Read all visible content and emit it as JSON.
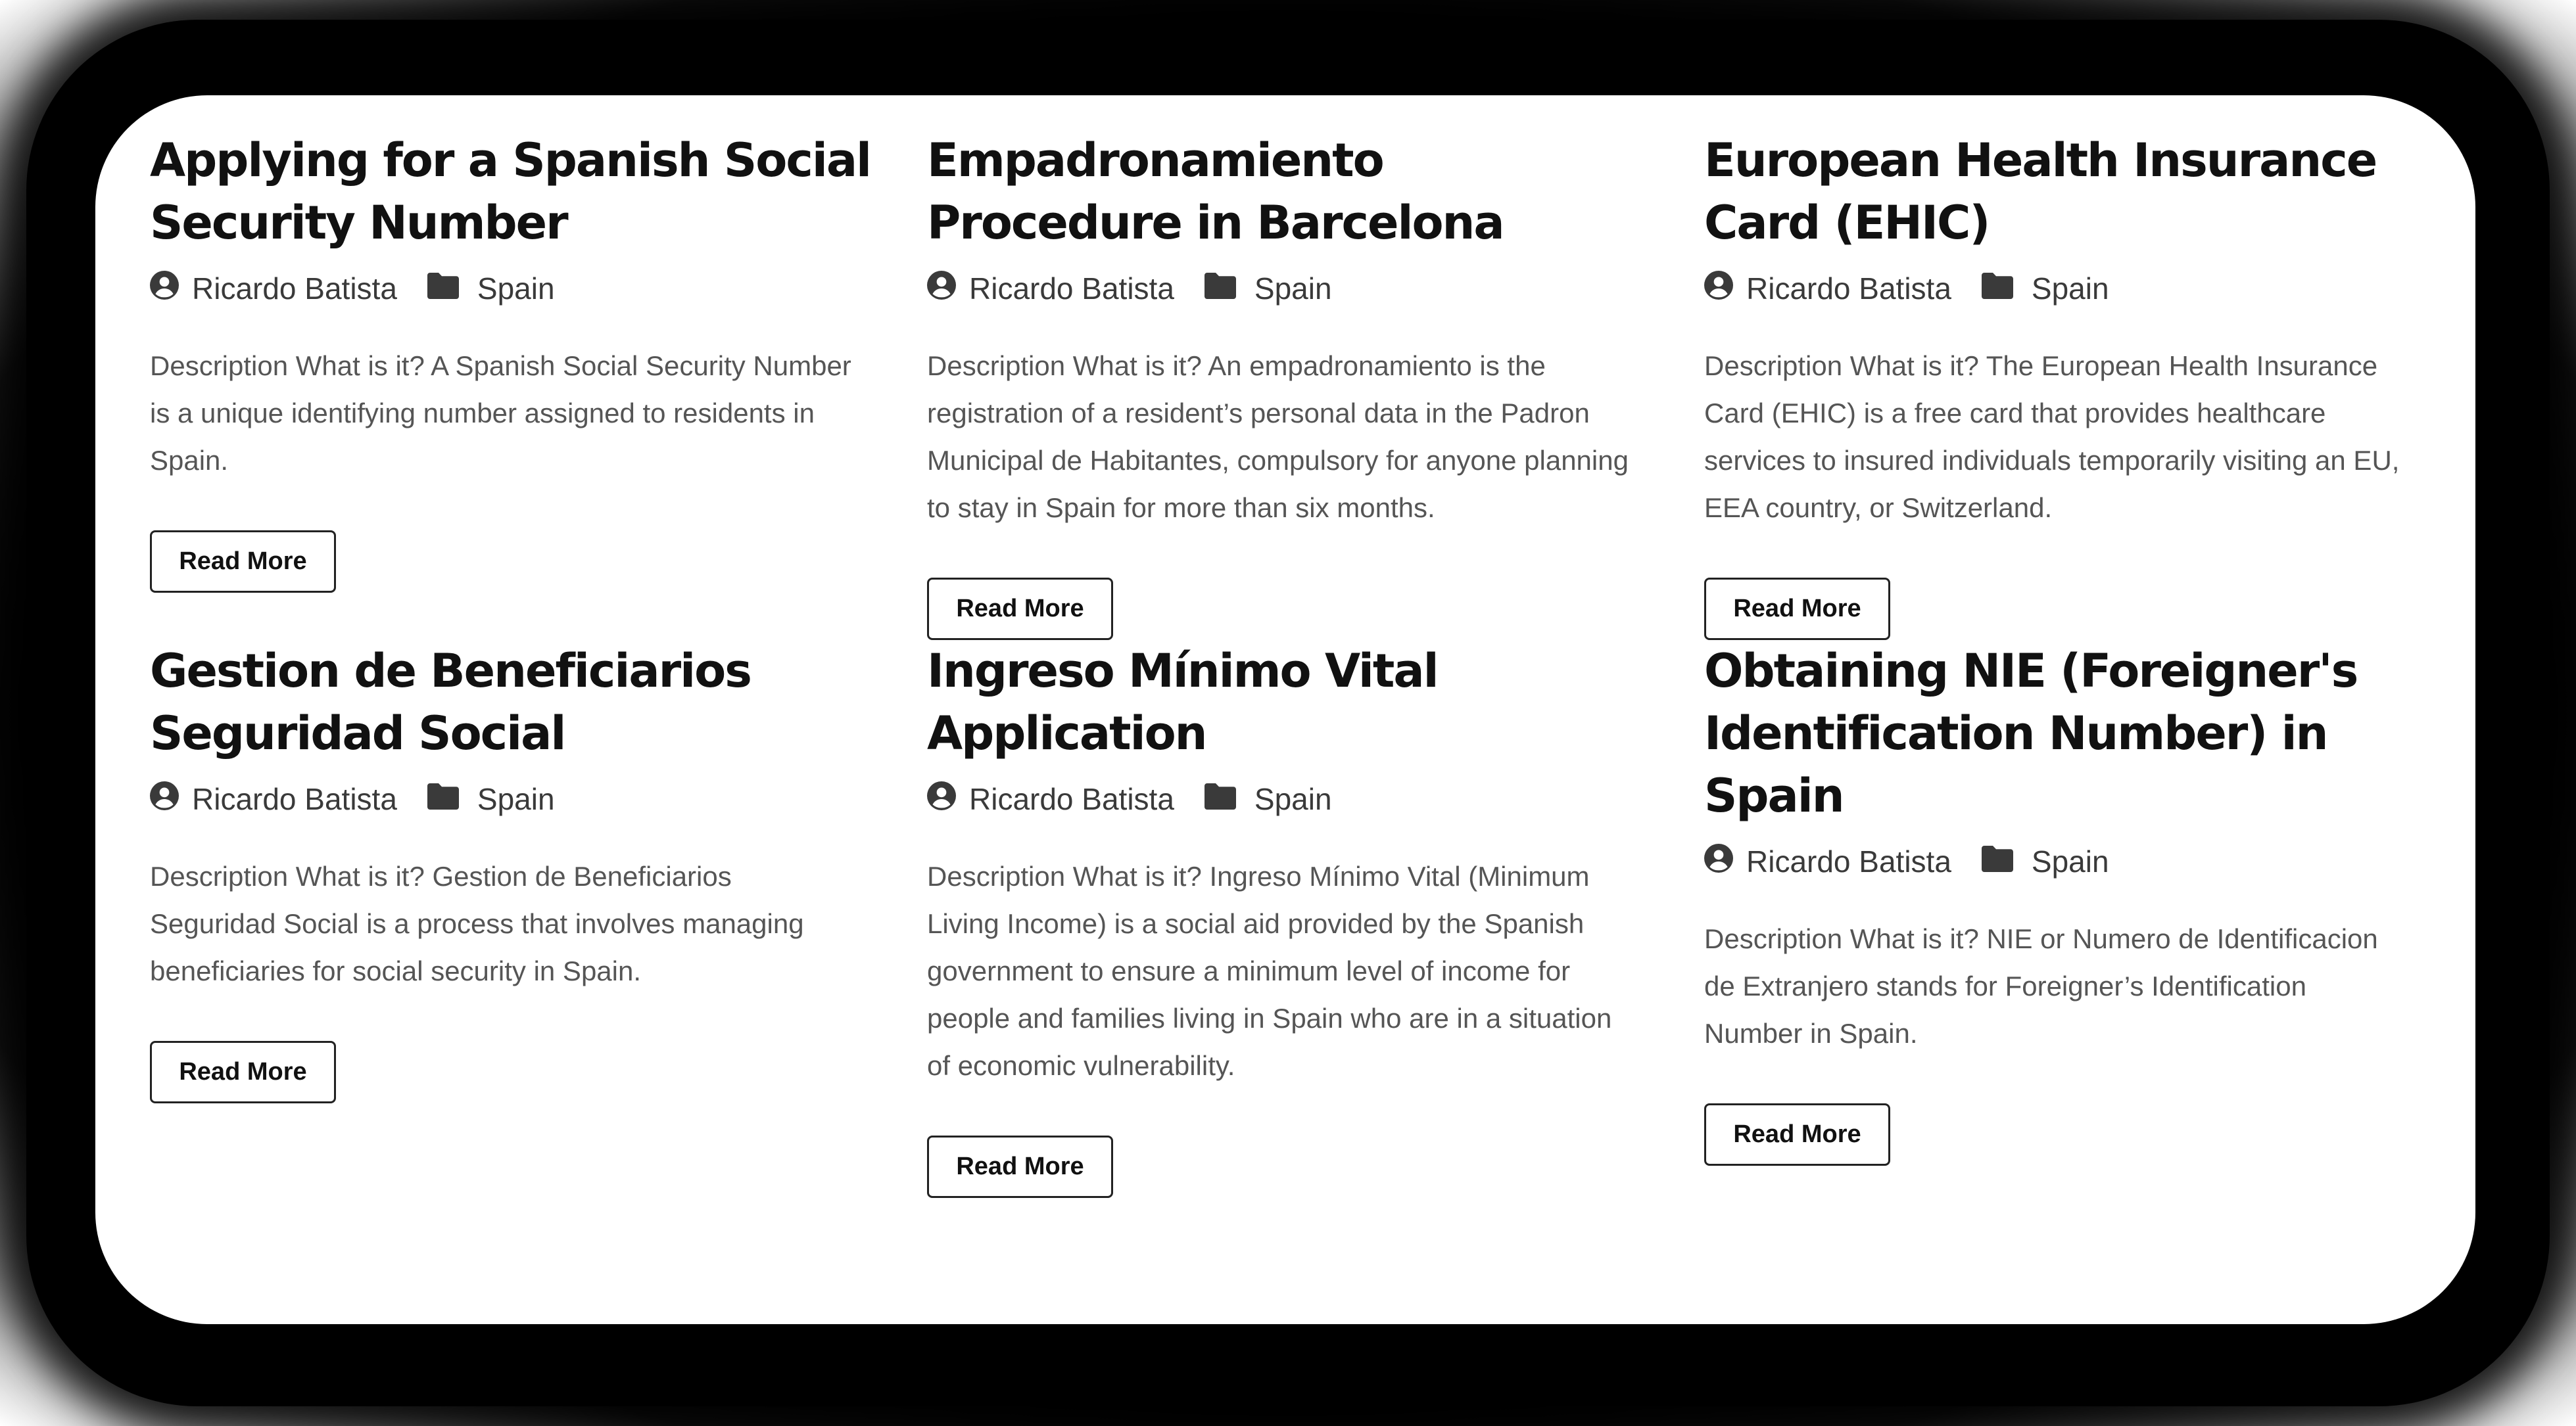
{
  "posts": [
    {
      "title": "Applying for a Spanish Social Security Number",
      "author": "Ricardo Batista",
      "category": "Spain",
      "description": "Description What is it? A Spanish Social Security Number is a unique identifying number assigned to residents in Spain.",
      "button": "Read More"
    },
    {
      "title": "Empadronamiento Procedure in Barcelona",
      "author": "Ricardo Batista",
      "category": "Spain",
      "description": "Description What is it? An empadronamiento is the registration of a resident’s personal data in the Padron Municipal de Habitantes, compulsory for anyone planning to stay in Spain for more than six months.",
      "button": "Read More"
    },
    {
      "title": "European Health Insurance Card (EHIC)",
      "author": "Ricardo Batista",
      "category": "Spain",
      "description": "Description What is it? The European Health Insurance Card (EHIC) is a free card that provides healthcare services to insured individuals temporarily visiting an EU, EEA country, or Switzerland.",
      "button": "Read More"
    },
    {
      "title": "Gestion de Beneficiarios Seguridad Social",
      "author": "Ricardo Batista",
      "category": "Spain",
      "description": "Description What is it? Gestion de Beneficiarios Seguridad Social is a process that involves managing beneficiaries for social security in Spain.",
      "button": "Read More"
    },
    {
      "title": "Ingreso Mínimo Vital Application",
      "author": "Ricardo Batista",
      "category": "Spain",
      "description": "Description What is it? Ingreso Mínimo Vital (Minimum Living Income) is a social aid provided by the Spanish government to ensure a minimum level of income for people and families living in Spain who are in a situation of economic vulnerability.",
      "button": "Read More"
    },
    {
      "title": "Obtaining NIE (Foreigner's Identification Number) in Spain",
      "author": "Ricardo Batista",
      "category": "Spain",
      "description": "Description What is it? NIE or Numero de Identificacion de Extranjero stands for Foreigner’s Identification Number in Spain.",
      "button": "Read More"
    }
  ],
  "icons": {
    "author": "user-circle-icon",
    "category": "folder-icon"
  },
  "colors": {
    "title": "#111111",
    "meta_text": "#3a3a3a",
    "description": "#555555",
    "button_border": "#222222"
  }
}
